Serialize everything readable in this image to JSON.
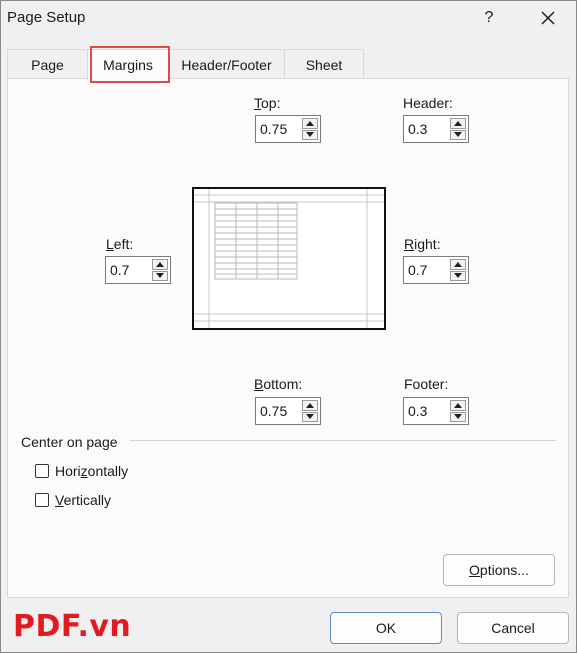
{
  "window": {
    "title": "Page Setup",
    "help_label": "?"
  },
  "tabs": [
    {
      "label": "Page",
      "selected": false
    },
    {
      "label": "Margins",
      "selected": true
    },
    {
      "label": "Header/Footer",
      "selected": false
    },
    {
      "label": "Sheet",
      "selected": false
    }
  ],
  "margins": {
    "top": {
      "label_accel": "T",
      "label_rest": "op:",
      "value": "0.75"
    },
    "header": {
      "label": "Header:",
      "value": "0.3"
    },
    "left": {
      "label_accel": "L",
      "label_rest": "eft:",
      "value": "0.7"
    },
    "right": {
      "label_accel": "R",
      "label_rest": "ight:",
      "value": "0.7"
    },
    "bottom": {
      "label_accel": "B",
      "label_rest": "ottom:",
      "value": "0.75"
    },
    "footer": {
      "label": "Footer:",
      "value": "0.3"
    }
  },
  "center_on_page": {
    "title": "Center on page",
    "horizontally": {
      "pre": "Hori",
      "accel": "z",
      "post": "ontally",
      "checked": false
    },
    "vertically": {
      "accel": "V",
      "post": "ertically",
      "checked": false
    }
  },
  "buttons": {
    "options": {
      "accel": "O",
      "rest": "ptions..."
    },
    "ok": "OK",
    "cancel": "Cancel"
  },
  "watermark": "PDF.vn",
  "colors": {
    "highlight": "#e04a4a",
    "watermark": "#e21b23"
  }
}
